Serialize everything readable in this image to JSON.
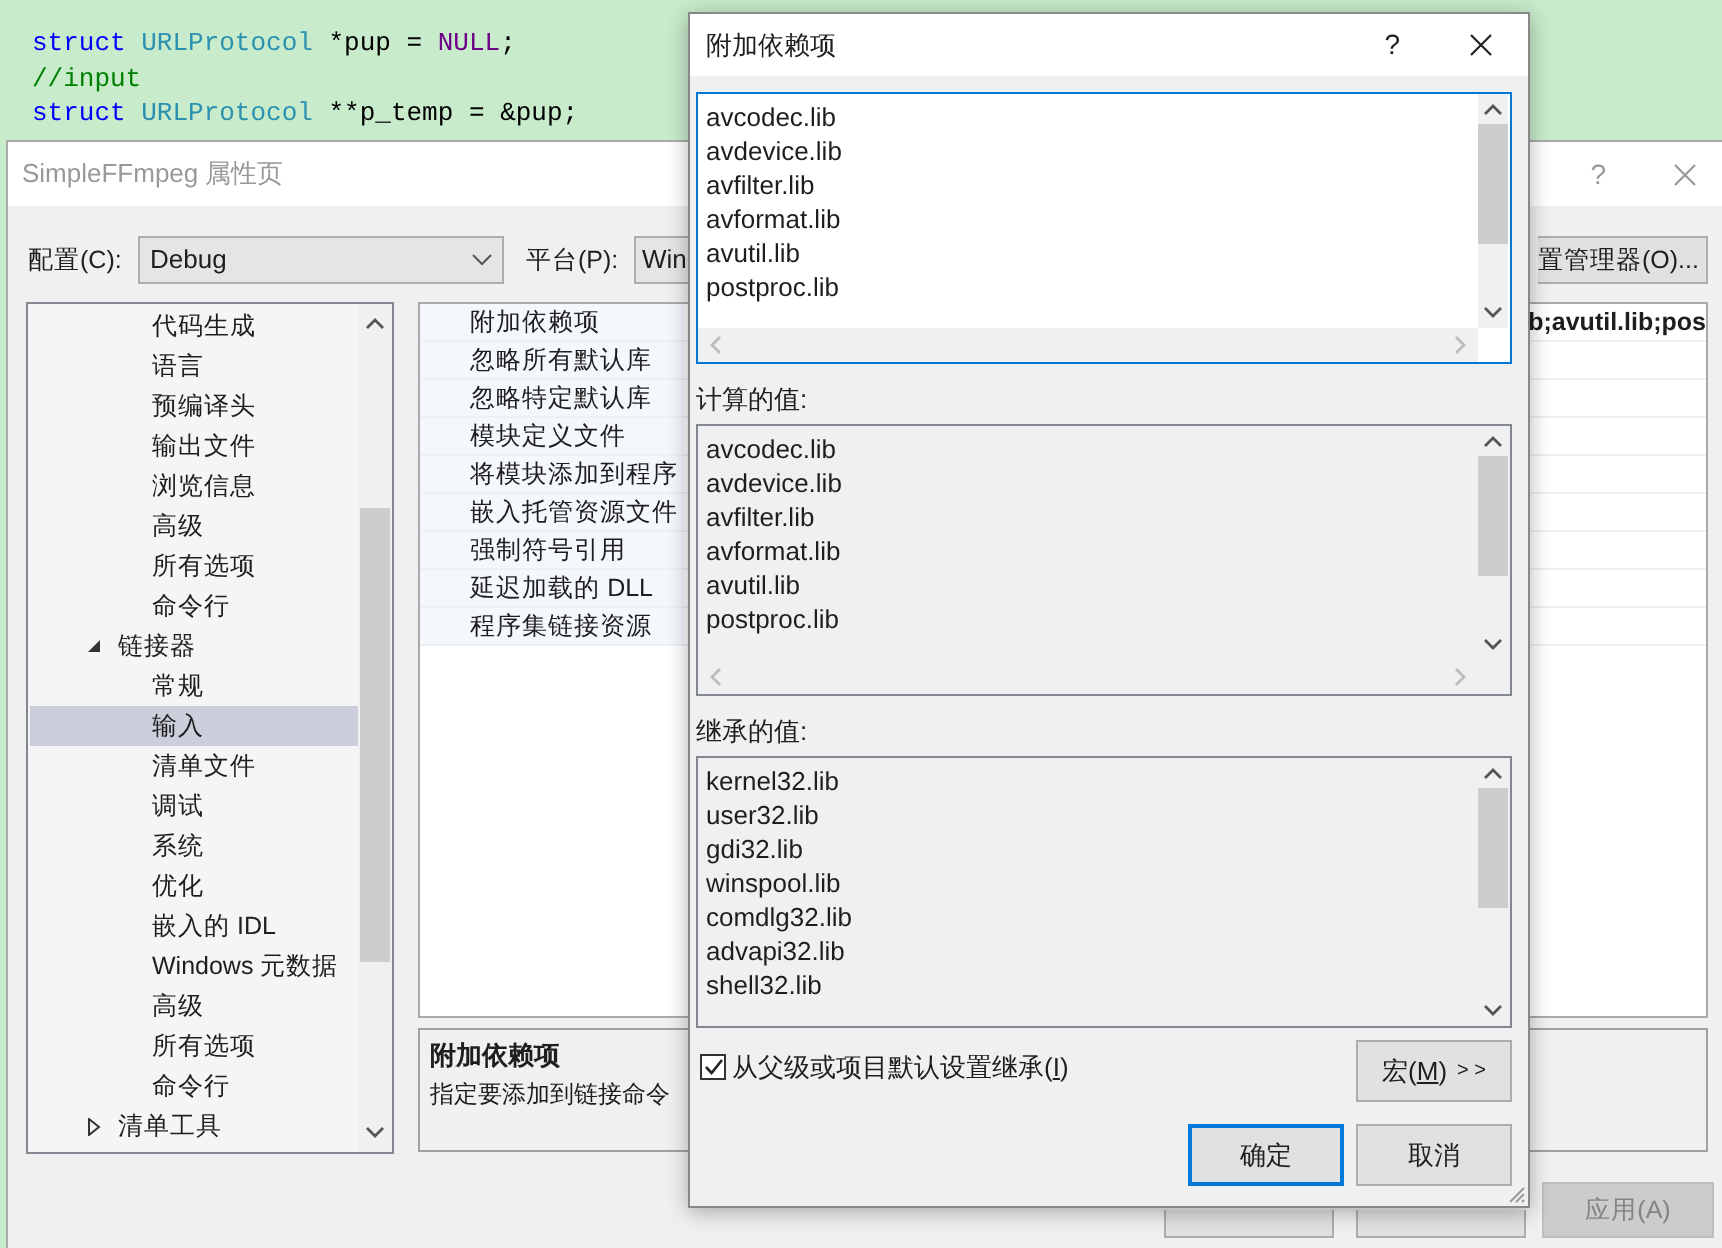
{
  "editor": {
    "code_lines": [
      [
        [
          {
            "kind": "keyword",
            "text": "struct"
          }
        ],
        [
          {
            "kind": "type",
            "text": "URLProtocol"
          }
        ],
        [
          {
            "kind": "plain",
            "text": "*pup"
          }
        ],
        [
          {
            "kind": "plain",
            "text": "="
          }
        ],
        [
          {
            "kind": "macro",
            "text": "NULL"
          },
          {
            "kind": "plain",
            "text": ";"
          }
        ]
      ],
      [
        [
          {
            "kind": "comment",
            "text": "//input"
          }
        ]
      ],
      [
        [
          {
            "kind": "keyword",
            "text": "struct"
          }
        ],
        [
          {
            "kind": "type",
            "text": "URLProtocol"
          }
        ],
        [
          {
            "kind": "plain",
            "text": "**p_temp"
          }
        ],
        [
          {
            "kind": "plain",
            "text": "="
          }
        ],
        [
          {
            "kind": "plain",
            "text": "&pup;"
          }
        ]
      ]
    ]
  },
  "property_window": {
    "title": "SimpleFFmpeg 属性页",
    "help": "?",
    "config": {
      "label": "配置(C):",
      "value": "Debug"
    },
    "platform": {
      "label": "平台(P):",
      "value": "Win"
    },
    "config_manager_button": "置管理器(O)...",
    "tree": [
      {
        "children": [
          {
            "label": "代码生成",
            "selected": false
          },
          {
            "label": "语言",
            "selected": false
          },
          {
            "label": "预编译头",
            "selected": false
          },
          {
            "label": "输出文件",
            "selected": false
          },
          {
            "label": "浏览信息",
            "selected": false
          },
          {
            "label": "高级",
            "selected": false
          },
          {
            "label": "所有选项",
            "selected": false
          },
          {
            "label": "命令行",
            "selected": false
          }
        ]
      },
      {
        "label": "链接器",
        "expanded": true,
        "selected": false,
        "children": [
          {
            "label": "常规",
            "selected": false
          },
          {
            "label": "输入",
            "selected": true
          },
          {
            "label": "清单文件",
            "selected": false
          },
          {
            "label": "调试",
            "selected": false
          },
          {
            "label": "系统",
            "selected": false
          },
          {
            "label": "优化",
            "selected": false
          },
          {
            "label": "嵌入的 IDL",
            "selected": false
          },
          {
            "label": "Windows 元数据",
            "selected": false
          },
          {
            "label": "高级",
            "selected": false
          },
          {
            "label": "所有选项",
            "selected": false
          },
          {
            "label": "命令行",
            "selected": false
          }
        ]
      },
      {
        "label": "清单工具",
        "expanded": false,
        "selected": false
      }
    ],
    "properties": [
      {
        "name": "附加依赖项",
        "value": "b;avutil.lib;pos"
      },
      {
        "name": "忽略所有默认库"
      },
      {
        "name": "忽略特定默认库"
      },
      {
        "name": "模块定义文件"
      },
      {
        "name": "将模块添加到程序"
      },
      {
        "name": "嵌入托管资源文件"
      },
      {
        "name": "强制符号引用"
      },
      {
        "name": "延迟加载的 DLL"
      },
      {
        "name": "程序集链接资源"
      }
    ],
    "description": {
      "title": "附加依赖项",
      "text": "指定要添加到链接命令"
    },
    "apply_button": {
      "label": "应用(A)",
      "disabled": true
    }
  },
  "dialog": {
    "title": "附加依赖项",
    "help": "?",
    "lists": [
      {
        "kind": "editable",
        "items": [
          "avcodec.lib",
          "avdevice.lib",
          "avfilter.lib",
          "avformat.lib",
          "avutil.lib",
          "postproc.lib"
        ]
      },
      {
        "kind": "readonly",
        "label": "计算的值:",
        "items": [
          "avcodec.lib",
          "avdevice.lib",
          "avfilter.lib",
          "avformat.lib",
          "avutil.lib",
          "postproc.lib"
        ]
      },
      {
        "kind": "readonly",
        "label": "继承的值:",
        "items": [
          "kernel32.lib",
          "user32.lib",
          "gdi32.lib",
          "winspool.lib",
          "comdlg32.lib",
          "advapi32.lib",
          "shell32.lib"
        ]
      }
    ],
    "inherit": {
      "checked": true,
      "label_before": "从父级或项目默认设置继承(",
      "access_key": "I",
      "label_after": ")"
    },
    "macro_button": {
      "label_before": "宏(",
      "access_key": "M",
      "label_after": ")",
      "arrows": "> >"
    },
    "ok_button": "确定",
    "cancel_button": "取消"
  }
}
